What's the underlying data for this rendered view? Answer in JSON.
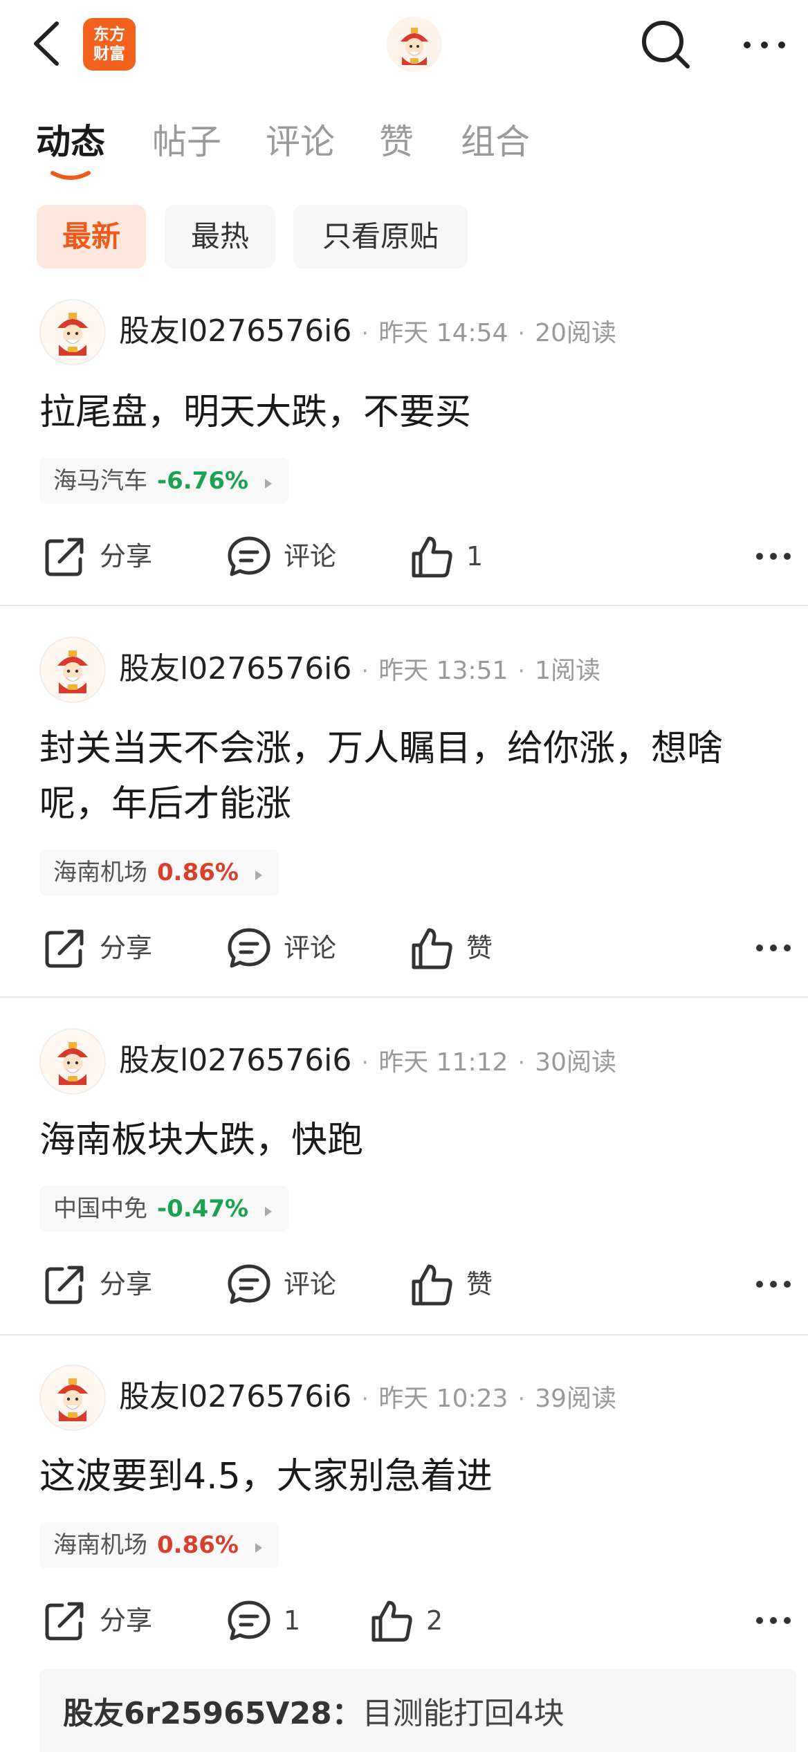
{
  "header": {
    "logo_line1": "东方",
    "logo_line2": "财富"
  },
  "tabs": [
    {
      "label": "动态",
      "active": true
    },
    {
      "label": "帖子",
      "active": false
    },
    {
      "label": "评论",
      "active": false
    },
    {
      "label": "赞",
      "active": false
    },
    {
      "label": "组合",
      "active": false
    }
  ],
  "filters": [
    {
      "label": "最新",
      "active": true
    },
    {
      "label": "最热",
      "active": false
    },
    {
      "label": "只看原贴",
      "active": false
    }
  ],
  "colors": {
    "accent": "#ec5a1c",
    "stock_down": "#1aa251",
    "stock_up": "#d6412b"
  },
  "posts": [
    {
      "username": "股友l0276576i6",
      "time": "昨天 14:54",
      "reads": "20阅读",
      "text": "拉尾盘，明天大跌，不要买",
      "stock_name": "海马汽车",
      "stock_change": "-6.76%",
      "share_label": "分享",
      "comment_label": "评论",
      "like_label": "1"
    },
    {
      "username": "股友l0276576i6",
      "time": "昨天 13:51",
      "reads": "1阅读",
      "text": "封关当天不会涨，万人瞩目，给你涨，想啥呢，年后才能涨",
      "stock_name": "海南机场",
      "stock_change": "0.86%",
      "share_label": "分享",
      "comment_label": "评论",
      "like_label": "赞"
    },
    {
      "username": "股友l0276576i6",
      "time": "昨天 11:12",
      "reads": "30阅读",
      "text": "海南板块大跌，快跑",
      "stock_name": "中国中免",
      "stock_change": "-0.47%",
      "share_label": "分享",
      "comment_label": "评论",
      "like_label": "赞"
    },
    {
      "username": "股友l0276576i6",
      "time": "昨天 10:23",
      "reads": "39阅读",
      "text": "这波要到4.5，大家别急着进",
      "stock_name": "海南机场",
      "stock_change": "0.86%",
      "share_label": "分享",
      "comment_label": "1",
      "like_label": "2"
    }
  ],
  "comment_preview": {
    "user": "股友6r25965V28：",
    "text": "目测能打回4块"
  }
}
